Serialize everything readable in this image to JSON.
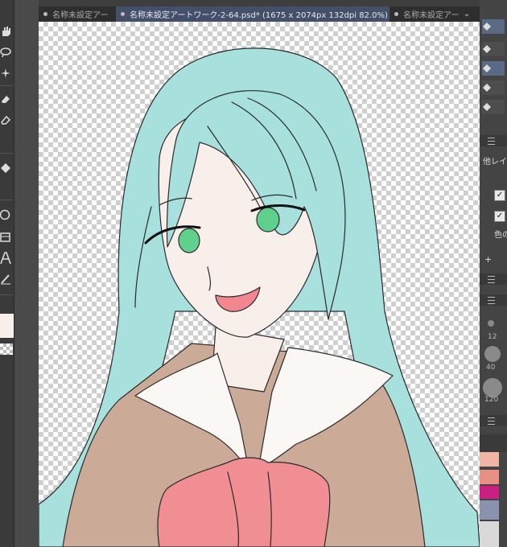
{
  "tabs": [
    {
      "label": "名称未設定アー",
      "active": false
    },
    {
      "label": "名称未設定アートワーク-2-64.psd* (1675 x 2074px 132dpi 82.0%)",
      "active": true
    },
    {
      "label": "名称未設定アー",
      "active": false
    }
  ],
  "tab_overflow": "⌄",
  "right_panel": {
    "layer_text": "他レイ",
    "color_text": "色の",
    "brush_sizes": [
      "12",
      "40",
      "120"
    ],
    "checkbox_mark": "✓",
    "add_icon": "+"
  },
  "colors": {
    "hair": "#a8e0de",
    "skin": "#f8eeea",
    "uniform": "#cbab98",
    "collar": "#fbf7f5",
    "ribbon": "#f08e93",
    "eyes": "#5fd18d",
    "mouth": "#f3878f",
    "palette": [
      "#f1b5a5",
      "#e98f84",
      "#f9ddd2",
      "#cc1f82",
      "#8a93ad",
      "#d9d9d9"
    ]
  },
  "tools": [
    "hand-icon",
    "lasso-icon",
    "magic-wand-icon",
    "eraser-icon",
    "eraser-soft-icon",
    "fill-icon",
    "ellipse-icon",
    "frame-icon",
    "text-icon",
    "pen-icon"
  ]
}
